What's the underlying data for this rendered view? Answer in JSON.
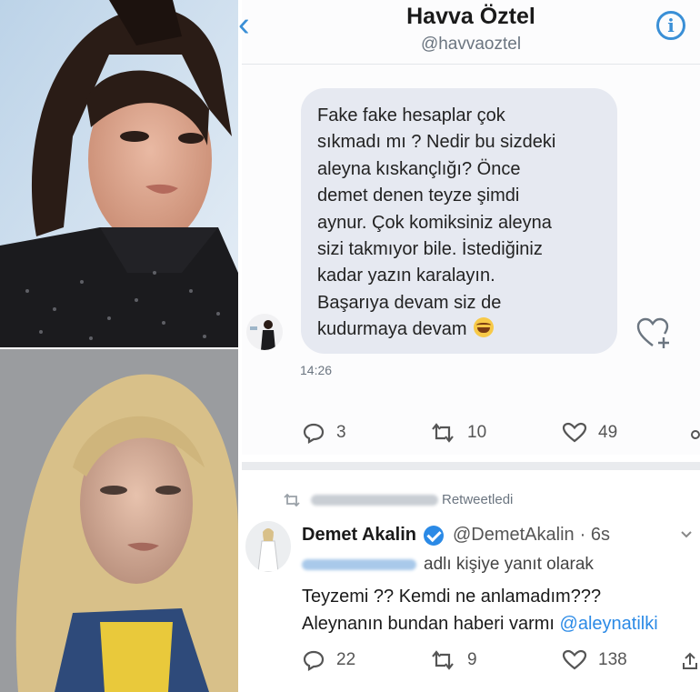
{
  "dm": {
    "title": "Havva Öztel",
    "handle": "@havvaoztel",
    "message_lines": [
      "Fake fake hesaplar çok",
      "sıkmadı mı ? Nedir bu sizdeki",
      "aleyna kıskançlığı? Önce",
      "demet denen teyze şimdi",
      "aynur. Çok komiksiniz aleyna",
      "sizi takmıyor bile. İstediğiniz",
      "kadar yazın karalayın.",
      "Başarıya devam siz de",
      "kudurmaya devam"
    ],
    "time": "14:26",
    "stats": {
      "replies": "3",
      "retweets": "10",
      "likes": "49"
    }
  },
  "tweet": {
    "retweeted_label": "Retweetledi",
    "name": "Demet Akalin",
    "handle": "@DemetAkalin",
    "age": "· 6s",
    "reply_label": "adlı kişiye yanıt olarak",
    "text_line1": "Teyzemi ?? Kemdi ne anlamadım???",
    "text_line2_prefix": "Aleynanın bundan haberi varmı",
    "mention": "@aleynatilki",
    "stats": {
      "replies": "22",
      "retweets": "9",
      "likes": "138"
    }
  },
  "colors": {
    "accent": "#2b8ae6",
    "bubble": "#e6e9f1",
    "muted": "#6b7580"
  }
}
